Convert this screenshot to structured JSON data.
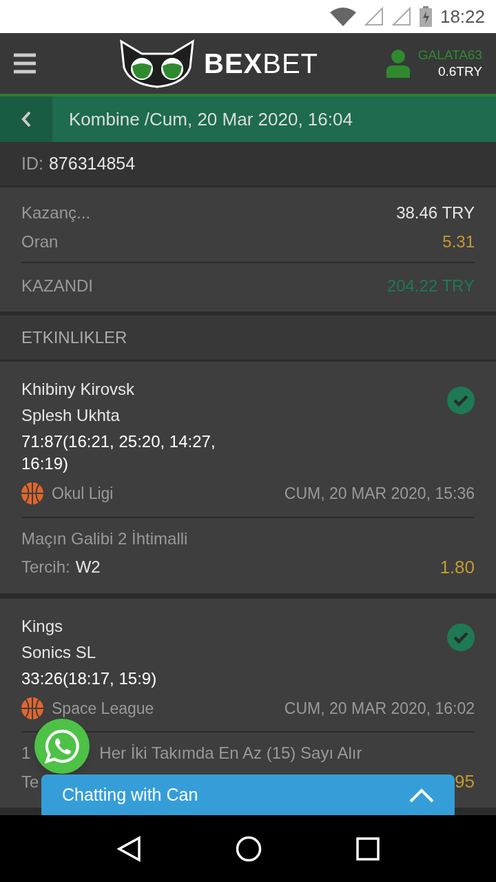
{
  "status_bar": {
    "time": "18:22"
  },
  "header": {
    "logo_bold": "BEX",
    "logo_light": "BET",
    "username": "GALATA63",
    "balance": "0.6TRY"
  },
  "title_bar": {
    "title": "Kombine /Cum, 20 Mar 2020, 16:04"
  },
  "ticket": {
    "id_label": "ID:",
    "id": "876314854",
    "rows": [
      {
        "label": "Kazanç...",
        "value": "38.46 TRY",
        "kind": "amount"
      },
      {
        "label": "Oran",
        "value": "5.31",
        "kind": "odds"
      }
    ],
    "result": {
      "label": "KAZANDI",
      "value": "204.22 TRY"
    }
  },
  "events_heading": "ETKINLIKLER",
  "events": [
    {
      "team_1": "Khibiny Kirovsk",
      "team_2": "Splesh Ukhta",
      "score": "71:87(16:21, 25:20, 14:27, 16:19)",
      "league": "Okul Ligi",
      "date": "CUM, 20 MAR 2020, 15:36",
      "market": [
        "Maçın Galibi 2 İhtimalli"
      ],
      "choice_label": "Tercih:",
      "choice": "W2",
      "odds": "1.80",
      "won": true
    },
    {
      "team_1": "Kings",
      "team_2": "Sonics SL",
      "score": "33:26(18:17, 15:9)",
      "league": "Space League",
      "date": "CUM, 20 MAR 2020, 16:02",
      "market": [
        "1",
        "Her İki Takımda En Az (15) Sayı Alır"
      ],
      "choice_label": "Te",
      "odds": "95",
      "won": true
    }
  ],
  "chat": {
    "title": "Chatting with Can"
  }
}
